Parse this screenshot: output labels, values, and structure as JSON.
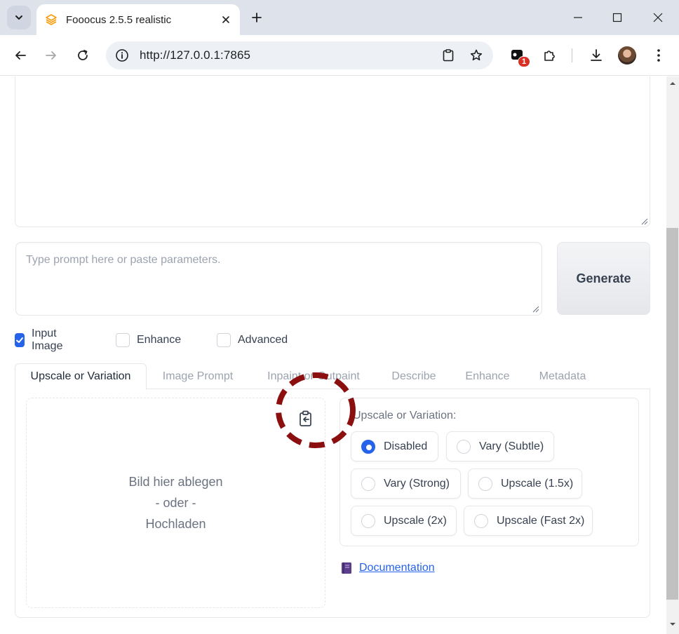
{
  "browser": {
    "tab_title": "Fooocus 2.5.5 realistic",
    "url": "http://127.0.0.1:7865",
    "extension_badge": "1"
  },
  "page": {
    "prompt_placeholder": "Type prompt here or paste parameters.",
    "generate_label": "Generate",
    "checkboxes": [
      {
        "label": "Input Image",
        "checked": true
      },
      {
        "label": "Enhance",
        "checked": false
      },
      {
        "label": "Advanced",
        "checked": false
      }
    ],
    "tabs": [
      {
        "label": "Upscale or Variation",
        "active": true
      },
      {
        "label": "Image Prompt",
        "active": false
      },
      {
        "label": "Inpaint or Outpaint",
        "active": false
      },
      {
        "label": "Describe",
        "active": false
      },
      {
        "label": "Enhance",
        "active": false
      },
      {
        "label": "Metadata",
        "active": false
      }
    ],
    "dropzone": {
      "line1": "Bild hier ablegen",
      "line2": "- oder -",
      "line3": "Hochladen"
    },
    "uov": {
      "title": "Upscale or Variation:",
      "options": [
        {
          "label": "Disabled",
          "selected": true
        },
        {
          "label": "Vary (Subtle)",
          "selected": false
        },
        {
          "label": "Vary (Strong)",
          "selected": false
        },
        {
          "label": "Upscale (1.5x)",
          "selected": false
        },
        {
          "label": "Upscale (2x)",
          "selected": false
        },
        {
          "label": "Upscale (Fast 2x)",
          "selected": false
        }
      ]
    },
    "documentation_label": "Documentation"
  },
  "colors": {
    "accent": "#2563eb",
    "highlight_ring": "#8b0f0f"
  }
}
